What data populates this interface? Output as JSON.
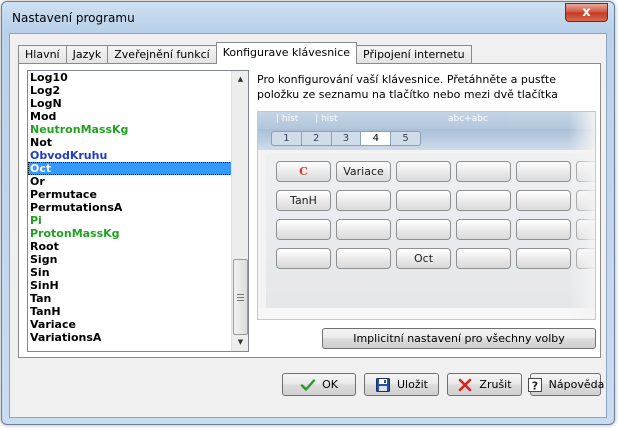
{
  "window": {
    "title": "Nastavení programu",
    "close_glyph": "x"
  },
  "tabs": [
    {
      "label": "Hlavní",
      "active": false
    },
    {
      "label": "Jazyk",
      "active": false
    },
    {
      "label": "Zveřejnění funkcí",
      "active": false
    },
    {
      "label": "Konfigurave klávesnice",
      "active": true
    },
    {
      "label": "Připojení internetu",
      "active": false
    }
  ],
  "function_list": {
    "items": [
      {
        "label": "Log10",
        "color": "#000000"
      },
      {
        "label": "Log2",
        "color": "#000000"
      },
      {
        "label": "LogN",
        "color": "#000000"
      },
      {
        "label": "Mod",
        "color": "#000000"
      },
      {
        "label": "NeutronMassKg",
        "color": "#22a022"
      },
      {
        "label": "Not",
        "color": "#000000"
      },
      {
        "label": "ObvodKruhu",
        "color": "#1f3cc8"
      },
      {
        "label": "Oct",
        "color": "#ffffff",
        "selected": true
      },
      {
        "label": "Or",
        "color": "#000000"
      },
      {
        "label": "Permutace",
        "color": "#000000"
      },
      {
        "label": "PermutationsA",
        "color": "#000000"
      },
      {
        "label": "Pi",
        "color": "#22a022"
      },
      {
        "label": "ProtonMassKg",
        "color": "#22a022"
      },
      {
        "label": "Root",
        "color": "#000000"
      },
      {
        "label": "Sign",
        "color": "#000000"
      },
      {
        "label": "Sin",
        "color": "#000000"
      },
      {
        "label": "SinH",
        "color": "#000000"
      },
      {
        "label": "Tan",
        "color": "#000000"
      },
      {
        "label": "TanH",
        "color": "#000000"
      },
      {
        "label": "Variace",
        "color": "#000000"
      },
      {
        "label": "VariationsA",
        "color": "#000000"
      }
    ],
    "scroll_up_icon": "scroll-up-arrow-icon",
    "scroll_down_icon": "scroll-down-arrow-icon"
  },
  "description": "Pro konfigurování vaší klávesnice. Přetáhněte a pusťte položku ze seznamu na tlačítko nebo mezi dvě tlačítka",
  "keyboard_preview": {
    "header_left_1": "| hist",
    "header_left_2": "| hist",
    "header_right": "abc+abc",
    "page_tabs": [
      "1",
      "2",
      "3",
      "4",
      "5"
    ],
    "active_page": "4",
    "keys": [
      [
        "C",
        "Variace",
        "",
        "",
        "",
        ""
      ],
      [
        "TanH",
        "",
        "",
        "",
        "",
        ""
      ],
      [
        "",
        "",
        "",
        "",
        "",
        ""
      ],
      [
        "",
        "",
        "Oct",
        "",
        "",
        ""
      ]
    ]
  },
  "buttons": {
    "reset": "Implicitní nastavení pro všechny volby",
    "ok": "OK",
    "save": "Uložit",
    "cancel": "Zrušit",
    "help": "Nápověda"
  },
  "colors": {
    "selection": "#3399ff",
    "ok_check": "#2e9a2e",
    "cancel_x": "#d42a1c",
    "save_disk": "#2b4f9c"
  }
}
